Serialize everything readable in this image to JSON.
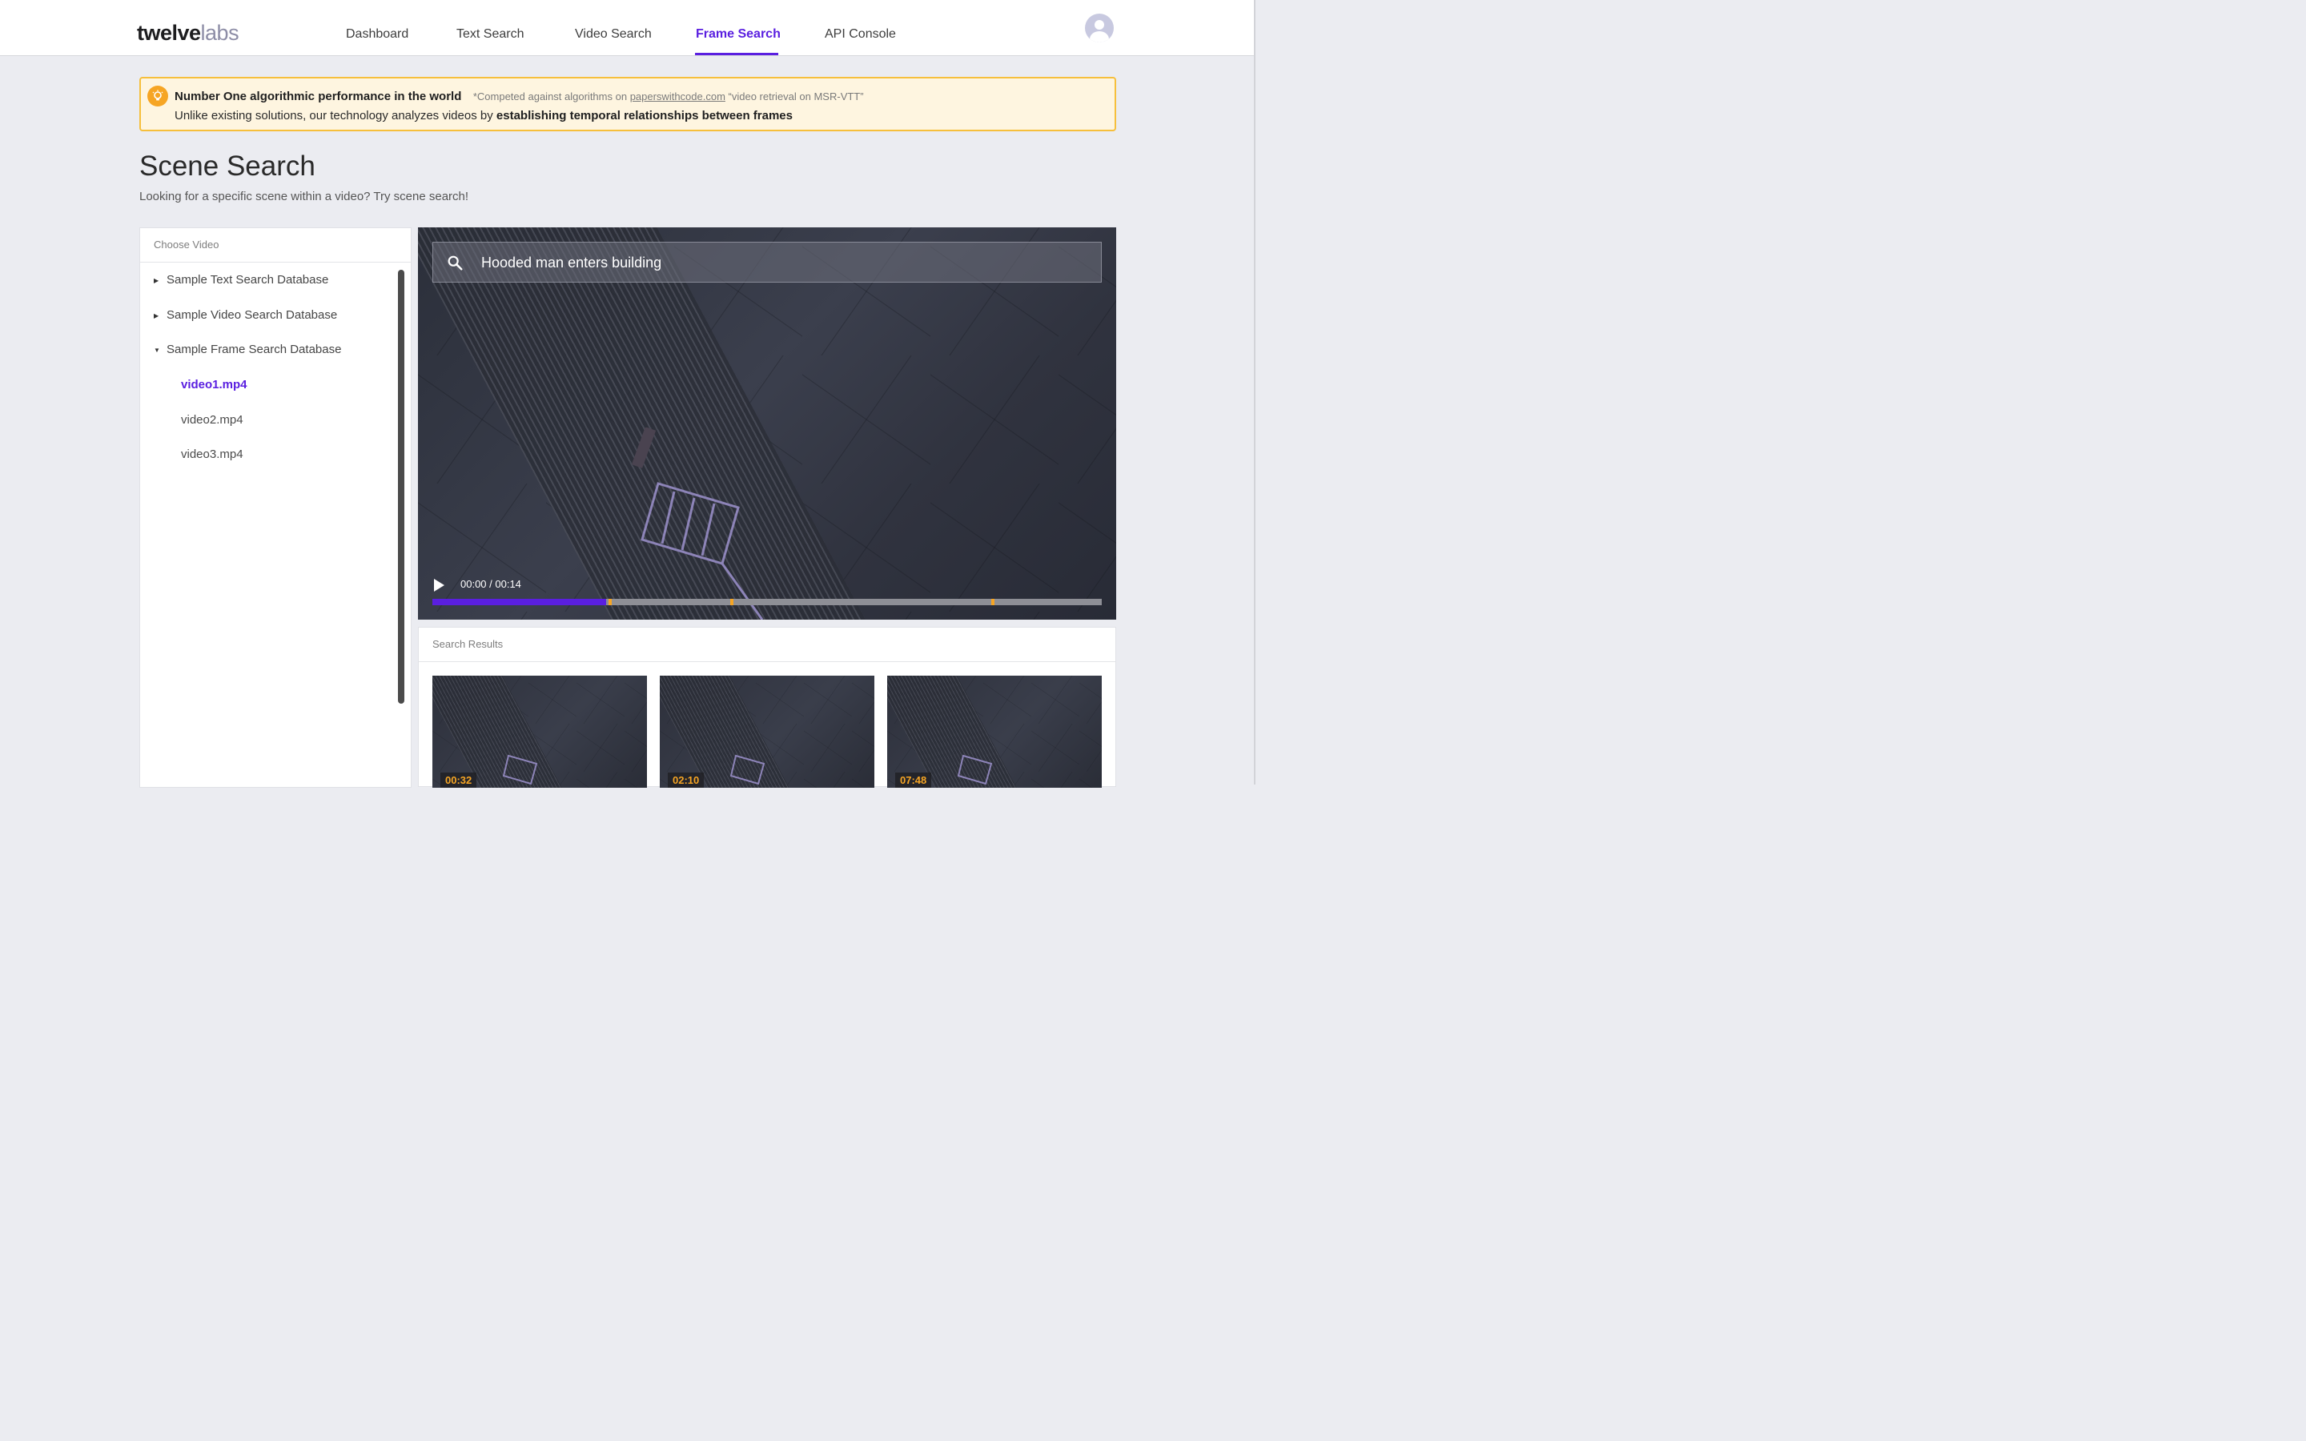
{
  "logo": {
    "part1": "twelve",
    "part2": "labs"
  },
  "nav": [
    {
      "label": "Dashboard"
    },
    {
      "label": "Text Search"
    },
    {
      "label": "Video Search"
    },
    {
      "label": "Frame Search",
      "active": true
    },
    {
      "label": "API Console"
    }
  ],
  "banner": {
    "headline": "Number One algorithmic performance in the world",
    "note_prefix": "*Competed against algorithms on ",
    "note_link": "paperswithcode.com",
    "note_suffix": " “video retrieval on MSR-VTT”",
    "body_prefix": "Unlike existing solutions, our technology analyzes videos by ",
    "body_bold": "establishing temporal relationships between frames"
  },
  "page": {
    "title": "Scene Search",
    "subtitle": "Looking for a specific scene within a video? Try scene search!"
  },
  "chooser": {
    "header": "Choose Video",
    "databases": [
      {
        "label": "Sample Text Search Database",
        "expanded": false
      },
      {
        "label": "Sample Video Search Database",
        "expanded": false
      },
      {
        "label": "Sample Frame Search Database",
        "expanded": true
      }
    ],
    "files": [
      {
        "label": "video1.mp4",
        "selected": true
      },
      {
        "label": "video2.mp4",
        "selected": false
      },
      {
        "label": "video3.mp4",
        "selected": false
      }
    ]
  },
  "player": {
    "query": "Hooded man enters building",
    "time": "00:00 / 00:14",
    "progress_fraction": 0.26,
    "marker_fractions": [
      0.263,
      0.445,
      0.835
    ]
  },
  "results": {
    "header": "Search Results",
    "items": [
      {
        "time": "00:32"
      },
      {
        "time": "02:10"
      },
      {
        "time": "07:48"
      }
    ]
  },
  "colors": {
    "accent": "#5a1fe0",
    "marker": "#f6a524",
    "banner_bg": "#fef5e0",
    "banner_border": "#f6bf3c"
  }
}
